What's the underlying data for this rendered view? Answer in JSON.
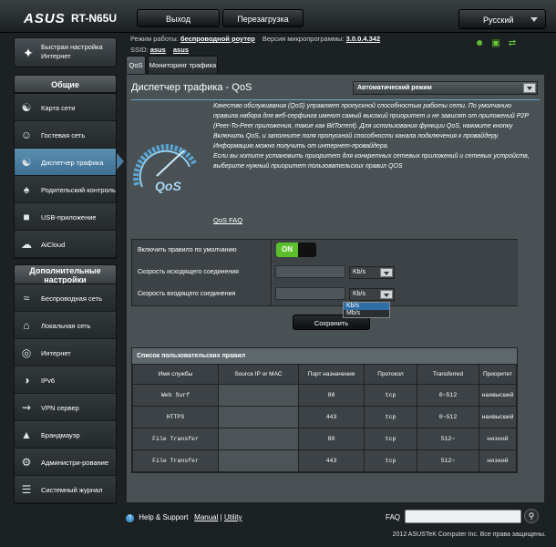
{
  "header": {
    "brand": "ASUS",
    "model": "RT-N65U",
    "logout_label": "Выход",
    "reboot_label": "Перезагрузка",
    "language": "Русский"
  },
  "infobar": {
    "mode_label": "Режим работы:",
    "mode_value": "беспроводной роутер",
    "fw_label": "Версия микропрограммы:",
    "fw_value": "3.0.0.4.342",
    "ssid_label": "SSID:",
    "ssid_values": [
      "asus",
      "asus"
    ]
  },
  "sidebar": {
    "quick_setup": "Быстрая настройка Интернет",
    "general_header": "Общие",
    "general_items": [
      {
        "label": "Карта сети",
        "icon": "network-map-icon"
      },
      {
        "label": "Гостевая сеть",
        "icon": "guest-network-icon"
      },
      {
        "label": "Диспетчер трафика",
        "icon": "traffic-manager-icon",
        "active": true
      },
      {
        "label": "Родительский контроль",
        "icon": "parental-control-icon"
      },
      {
        "label": "USB-приложение",
        "icon": "usb-app-icon"
      },
      {
        "label": "AiCloud",
        "icon": "aicloud-icon"
      }
    ],
    "advanced_header": "Дополнительные настройки",
    "advanced_items": [
      {
        "label": "Беспроводная сеть",
        "icon": "wireless-icon"
      },
      {
        "label": "Локальная сеть",
        "icon": "lan-icon"
      },
      {
        "label": "Интернет",
        "icon": "wan-icon"
      },
      {
        "label": "IPv6",
        "icon": "ipv6-icon"
      },
      {
        "label": "VPN сервер",
        "icon": "vpn-icon"
      },
      {
        "label": "Брандмауэр",
        "icon": "firewall-icon"
      },
      {
        "label": "Администри-рование",
        "icon": "administration-icon"
      },
      {
        "label": "Системный журнал",
        "icon": "system-log-icon"
      }
    ]
  },
  "tabs": [
    "QoS",
    "Мониторинг трафика"
  ],
  "main": {
    "title": "Диспетчер трафика - QoS",
    "mode_select": "Автоматический режим",
    "description_1": "Качество обслуживания (QoS) управляет пропускной способностью работы сети. По умолчанию правила набора для веб-серфинга имеют самый высокий приоритет и не зависят от приложений P2P (Peer-To-Peer приложения, такие как BitTorrent). Для использования функции QoS, нажмите кнопку Включить QoS, и заполните поля пропускной способности канала подключения к провайдеру. Информацию можно получить от интернет-провайдера.",
    "description_2": "Если вы хотите установить приоритет для конкретных сетевых приложений и сетевых устройств, выберите нужный приоритет пользовательских правил QOS",
    "qos_faq": "QoS FAQ",
    "settings": {
      "enable_label": "Включить правило по умолчанию",
      "enable_value": "ON",
      "upload_label": "Скорость исходящего соединения",
      "upload_unit": "Kb/s",
      "download_label": "Скорость входящего соединения",
      "download_unit": "Kb/s",
      "unit_options": [
        "Kb/s",
        "Mb/s"
      ]
    },
    "save_label": "Сохранить",
    "rules": {
      "title": "Список пользовательских правил",
      "columns": [
        "Имя службы",
        "Source IP or MAC",
        "Порт назначения",
        "Протокол",
        "Transferred",
        "Приоритет"
      ],
      "rows": [
        [
          "Web Surf",
          "",
          "80",
          "tcp",
          "0~512",
          "наивысший"
        ],
        [
          "HTTPS",
          "",
          "443",
          "tcp",
          "0~512",
          "наивысший"
        ],
        [
          "File Transfer",
          "",
          "80",
          "tcp",
          "512~",
          "низкий"
        ],
        [
          "File Transfer",
          "",
          "443",
          "tcp",
          "512~",
          "низкий"
        ]
      ]
    }
  },
  "footer": {
    "help_support": "Help & Support",
    "manual": "Manual",
    "separator": "|",
    "utility": "Utility",
    "faq": "FAQ",
    "copyright": "2012 ASUSTeK Computer Inc. Все права защищены."
  }
}
